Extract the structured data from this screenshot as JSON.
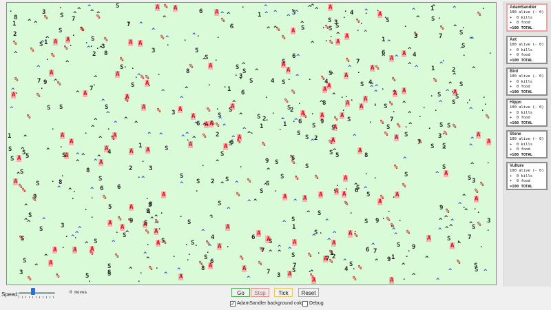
{
  "species": [
    {
      "name": "AdamSandler",
      "alive": "100 alive (- 0)",
      "kills": "+  0 kills",
      "food": "+  0 food",
      "total": "=100 TOTAL",
      "active": true
    },
    {
      "name": "Ant",
      "alive": "100 alive (- 0)",
      "kills": "+  0 kills",
      "food": "+  0 food",
      "total": "=100 TOTAL",
      "active": false
    },
    {
      "name": "Bird",
      "alive": "100 alive (- 0)",
      "kills": "+  0 kills",
      "food": "+  0 food",
      "total": "=100 TOTAL",
      "active": false
    },
    {
      "name": "Hippo",
      "alive": "100 alive (- 0)",
      "kills": "+  0 kills",
      "food": "+  0 food",
      "total": "=100 TOTAL",
      "active": false
    },
    {
      "name": "Stone",
      "alive": "100 alive (- 0)",
      "kills": "+  0 kills",
      "food": "+  0 food",
      "total": "=100 TOTAL",
      "active": false
    },
    {
      "name": "Vulture",
      "alive": "100 alive (- 0)",
      "kills": "+  0 kills",
      "food": "+  0 food",
      "total": "=100 TOTAL",
      "active": false
    }
  ],
  "controls": {
    "speed_label": "Speed:",
    "moves_text": "0 moves",
    "go": "Go",
    "stop": "Stop",
    "tick": "Tick",
    "reset": "Reset",
    "bg_colors_label": "AdamSandler background colors",
    "bg_colors_checked": true,
    "debug_label": "Debug",
    "debug_checked": false,
    "speed_level": 0.35
  },
  "colors": {
    "arena_bg": "#d9fbd7",
    "adam_fg": "#d01010",
    "adam_bg": "#f7b3b3",
    "bird": "#2a4fd0",
    "active_border": "#f4a3a3"
  },
  "critters": {
    "count_each": 100,
    "glyphs": {
      "AdamSandler": "A",
      "Ant": "%",
      "Bird": "^",
      "Hippo": "1-9",
      "Stone": "S",
      "Vulture": "^"
    }
  }
}
